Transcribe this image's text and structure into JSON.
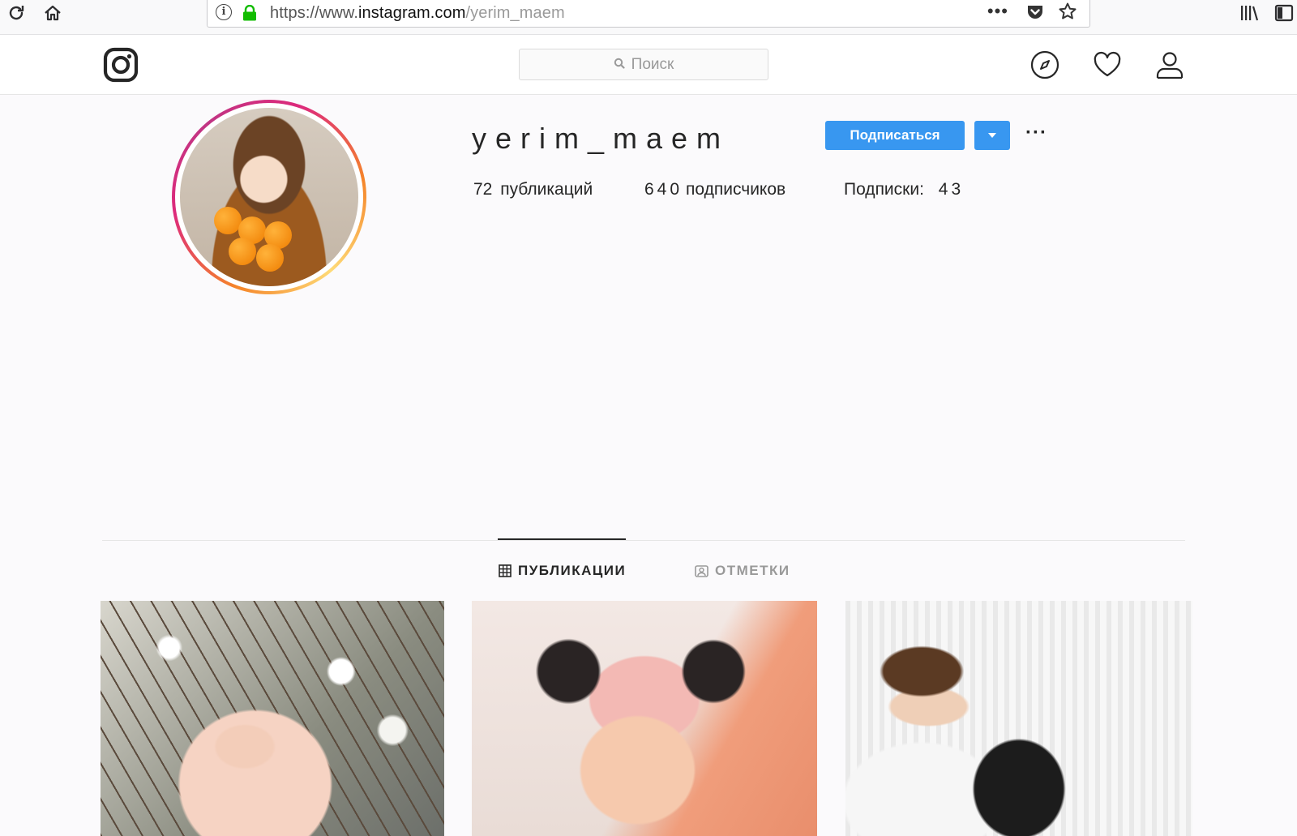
{
  "browser": {
    "url_host_prefix": "https://www.",
    "url_host": "instagram.com",
    "url_path": "/yerim_maem",
    "url_more": "•••"
  },
  "search": {
    "placeholder": "Поиск"
  },
  "profile": {
    "username": "yerim_maem",
    "follow_label": "Подписаться",
    "more_label": "···",
    "posts_count": "72",
    "posts_label": "публикаций",
    "followers_count": "640",
    "followers_label": "подписчиков",
    "following_label": "Подписки:",
    "following_count": "43"
  },
  "tabs": [
    {
      "label": "ПУБЛИКАЦИИ",
      "active": true
    },
    {
      "label": "ОТМЕТКИ",
      "active": false
    }
  ],
  "colors": {
    "accent": "#3897f0",
    "lock": "#12bc00",
    "text": "#262626",
    "muted": "#999999"
  },
  "icons": [
    "reload-icon",
    "home-icon",
    "info-icon",
    "lock-icon",
    "pocket-icon",
    "star-icon",
    "library-icon",
    "sidebar-icon",
    "instagram-logo-icon",
    "search-icon",
    "explore-compass-icon",
    "heart-icon",
    "profile-icon",
    "grid-icon",
    "tagged-icon"
  ]
}
